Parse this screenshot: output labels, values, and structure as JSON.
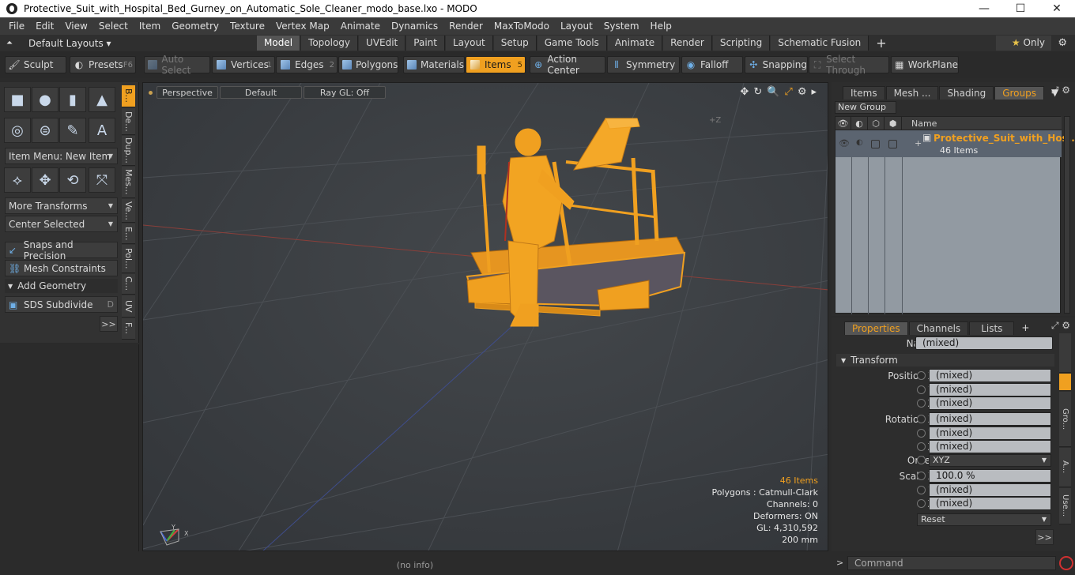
{
  "window": {
    "title": "Protective_Suit_with_Hospital_Bed_Gurney_on_Automatic_Sole_Cleaner_modo_base.lxo - MODO",
    "controls": [
      "—",
      "☐",
      "✕"
    ]
  },
  "menu": [
    "File",
    "Edit",
    "View",
    "Select",
    "Item",
    "Geometry",
    "Texture",
    "Vertex Map",
    "Animate",
    "Dynamics",
    "Render",
    "MaxToModo",
    "Layout",
    "System",
    "Help"
  ],
  "layout": {
    "preset": "Default Layouts ▾",
    "tabs": [
      "Model",
      "Topology",
      "UVEdit",
      "Paint",
      "Layout",
      "Setup",
      "Game Tools",
      "Animate",
      "Render",
      "Scripting",
      "Schematic Fusion"
    ],
    "active_tab": "Model",
    "add": "+",
    "only_label": "Only"
  },
  "toolbar": {
    "sculpt": "Sculpt",
    "presets": "Presets",
    "presets_key": "F6",
    "auto_select": "Auto Select",
    "vertices": "Vertices",
    "vertices_key": "1",
    "edges": "Edges",
    "edges_key": "2",
    "polygons": "Polygons",
    "materials": "Materials",
    "items": "Items",
    "items_key": "5",
    "action_center": "Action Center",
    "symmetry": "Symmetry",
    "falloff": "Falloff",
    "snapping": "Snapping",
    "select_through": "Select Through",
    "workplane": "WorkPlane"
  },
  "left": {
    "item_menu": "Item Menu: New Item",
    "more_transforms": "More Transforms",
    "center_selected": "Center Selected",
    "snaps": "Snaps and Precision",
    "mesh_constraints": "Mesh Constraints",
    "add_geometry": "Add Geometry",
    "sds": "SDS Subdivide",
    "sds_key": "D",
    "more": ">>",
    "vtabs": [
      "B...",
      "De...",
      "Dup...",
      "Mes...",
      "Ve...",
      "E...",
      "Pol...",
      "C...",
      "UV",
      "F..."
    ]
  },
  "viewport": {
    "view": "Perspective",
    "shading": "Default",
    "raygl": "Ray GL: Off",
    "axis_label": "+Z",
    "info": {
      "items": "46 Items",
      "polygons": "Polygons : Catmull-Clark",
      "channels": "Channels: 0",
      "deformers": "Deformers: ON",
      "gl": "GL: 4,310,592",
      "scale": "200 mm"
    },
    "gizmo": {
      "y": "Y",
      "x": "X"
    }
  },
  "status": "(no info)",
  "groups_panel": {
    "tabs": [
      "Items",
      "Mesh ...",
      "Shading",
      "Groups"
    ],
    "active_tab": "Groups",
    "new_group": "New Group",
    "col_name": "Name",
    "row_name": "Protective_Suit_with_Hos...",
    "row_sub": "46 Items"
  },
  "properties": {
    "tabs": [
      "Properties",
      "Channels",
      "Lists"
    ],
    "active_tab": "Properties",
    "add": "+",
    "name_label": "Name",
    "name_value": "(mixed)",
    "transform": "Transform",
    "position_label": "Position X",
    "rotation_label": "Rotation X",
    "scale_label": "Scale X",
    "y": "Y",
    "z": "Z",
    "mixed": "(mixed)",
    "order_label": "Order",
    "order_value": "XYZ",
    "scale_x": "100.0 %",
    "reset": "Reset",
    "more": ">>",
    "side_tabs": [
      "Gro...",
      "A...",
      "Use..."
    ]
  },
  "command": {
    "prompt": ">",
    "placeholder": "Command"
  }
}
